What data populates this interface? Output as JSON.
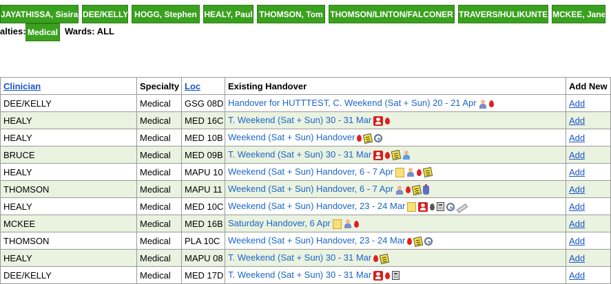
{
  "clinicians": [
    {
      "label": "JAYATHISSA, Sisira"
    },
    {
      "label": "DEE/KELLY"
    },
    {
      "label": "HOGG, Stephen"
    },
    {
      "label": "HEALY, Paul"
    },
    {
      "label": "THOMSON, Tom"
    },
    {
      "label": "THOMSON/LINTON/FALCONER"
    },
    {
      "label": "TRAVERS/HULIKUNTE"
    },
    {
      "label": "MCKEE, Jane"
    }
  ],
  "filters": {
    "specialties_label": "alties:",
    "specialty_selected": "Medical",
    "wards_label": "Wards: ALL"
  },
  "table": {
    "headers": {
      "clinician": "Clinician",
      "specialty": "Specialty",
      "loc": "Loc",
      "handover": "Existing Handover",
      "add": "Add New"
    },
    "rows": [
      {
        "clinician": "DEE/KELLY",
        "specialty": "Medical",
        "loc": "GSG 08D",
        "handover": "Handover for HUTTTEST, C. Weekend (Sat + Sun) 20 - 21 Apr",
        "icons": [
          "person-icon",
          "blood-drop-icon"
        ],
        "add": "Add"
      },
      {
        "clinician": "HEALY",
        "specialty": "Medical",
        "loc": "MED 16C",
        "handover": "T. Weekend (Sat + Sun) 30 - 31 Mar",
        "icons": [
          "red-card-icon",
          "blood-drop-icon"
        ],
        "add": "Add"
      },
      {
        "clinician": "HEALY",
        "specialty": "Medical",
        "loc": "MED 10B",
        "handover": "Weekend (Sat + Sun) Handover",
        "icons": [
          "blood-drop-icon",
          "notepad-icon",
          "stethoscope-icon"
        ],
        "add": "Add"
      },
      {
        "clinician": "BRUCE",
        "specialty": "Medical",
        "loc": "MED 09B",
        "handover": "T. Weekend (Sat + Sun) 30 - 31 Mar",
        "icons": [
          "red-card-icon",
          "blood-drop-icon",
          "notepad-icon",
          "person-blue-icon"
        ],
        "add": "Add"
      },
      {
        "clinician": "HEALY",
        "specialty": "Medical",
        "loc": "MAPU 10",
        "handover": "Weekend (Sat + Sun) Handover, 6 - 7 Apr",
        "icons": [
          "note-icon",
          "person-icon",
          "blood-drop-icon",
          "notepad-icon"
        ],
        "add": "Add"
      },
      {
        "clinician": "THOMSON",
        "specialty": "Medical",
        "loc": "MAPU 11",
        "handover": "Weekend (Sat + Sun) Handover, 6 - 7 Apr",
        "icons": [
          "person-icon",
          "blood-drop-icon",
          "notepad-icon",
          "bottle-icon"
        ],
        "add": "Add"
      },
      {
        "clinician": "HEALY",
        "specialty": "Medical",
        "loc": "MED 10C",
        "handover": "Weekend (Sat + Sun) Handover, 23 - 24 Mar",
        "icons": [
          "note-icon",
          "red-card-icon",
          "blood-drop-dark-icon",
          "calculator-icon",
          "stethoscope-icon",
          "syringe-icon"
        ],
        "add": "Add"
      },
      {
        "clinician": "MCKEE",
        "specialty": "Medical",
        "loc": "MED 16B",
        "handover": "Saturday Handover, 6 Apr",
        "icons": [
          "note-icon",
          "person-icon",
          "blood-drop-icon"
        ],
        "add": "Add"
      },
      {
        "clinician": "THOMSON",
        "specialty": "Medical",
        "loc": "PLA 10C",
        "handover": "Weekend (Sat + Sun) Handover, 23 - 24 Mar",
        "icons": [
          "blood-drop-icon",
          "notepad-icon",
          "stethoscope-icon"
        ],
        "add": "Add"
      },
      {
        "clinician": "HEALY",
        "specialty": "Medical",
        "loc": "MAPU 08",
        "handover": "T. Weekend (Sat + Sun) 30 - 31 Mar",
        "icons": [
          "blood-drop-icon",
          "notepad-icon"
        ],
        "add": "Add"
      },
      {
        "clinician": "DEE/KELLY",
        "specialty": "Medical",
        "loc": "MED 17D",
        "handover": "T. Weekend (Sat + Sun) 30 - 31 Mar",
        "icons": [
          "red-card-icon",
          "blood-drop-icon",
          "calculator-icon"
        ],
        "add": "Add"
      }
    ]
  }
}
